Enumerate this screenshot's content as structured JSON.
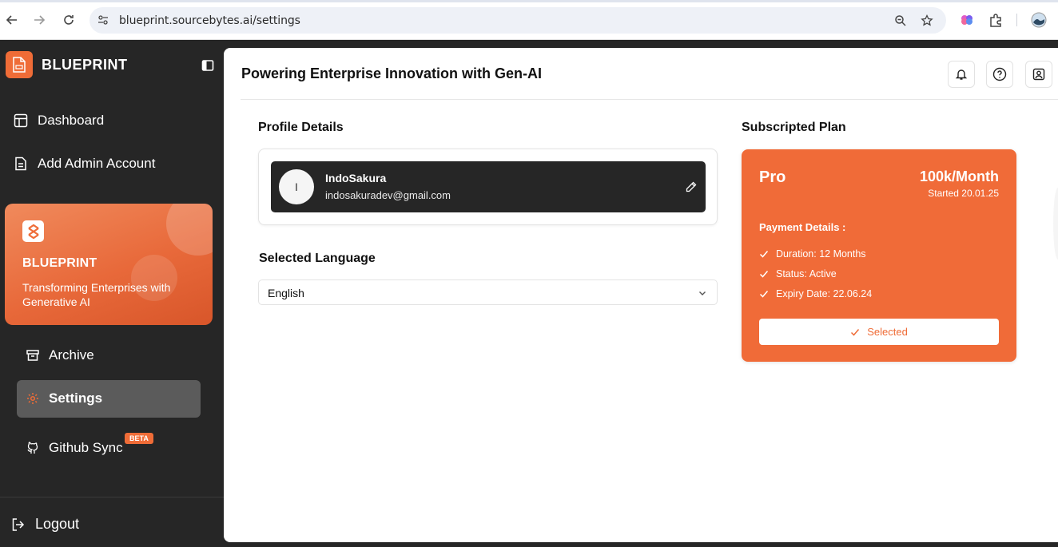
{
  "browser": {
    "url": "blueprint.sourcebytes.ai/settings",
    "icons": [
      "back-icon",
      "forward-icon",
      "reload-icon",
      "site-info-icon",
      "zoom-icon",
      "bookmark-star-icon",
      "extension-brain-icon",
      "extensions-puzzle-icon",
      "profile-avatar-icon"
    ]
  },
  "sidebar": {
    "brand": "BLUEPRINT",
    "items": [
      {
        "label": "Dashboard",
        "icon": "dashboard-icon"
      },
      {
        "label": "Add Admin Account",
        "icon": "document-icon"
      }
    ],
    "promo": {
      "title": "BLUEPRINT",
      "text": "Transforming Enterprises with Generative AI"
    },
    "sub_items": [
      {
        "label": "Archive",
        "icon": "archive-icon"
      },
      {
        "label": "Settings",
        "icon": "gear-icon",
        "active": true
      },
      {
        "label": "Github Sync",
        "icon": "github-icon",
        "badge": "BETA"
      }
    ],
    "logout": "Logout",
    "accent": "#ef6c37"
  },
  "main": {
    "title": "Powering Enterprise Innovation with Gen-AI",
    "profile_section_title": "Profile Details",
    "profile": {
      "initial": "I",
      "name": "IndoSakura",
      "email": "indosakuradev@gmail.com"
    },
    "language_section_title": "Selected Language",
    "language": "English",
    "plan_section_title": "Subscripted Plan",
    "plan": {
      "name": "Pro",
      "price": "100k/Month",
      "started": "Started 20.01.25",
      "payment_title": "Payment Details :",
      "details": [
        "Duration: 12 Months",
        "Status: Active",
        "Expiry Date: 22.06.24"
      ],
      "button": "Selected",
      "color": "#f06b38"
    }
  }
}
